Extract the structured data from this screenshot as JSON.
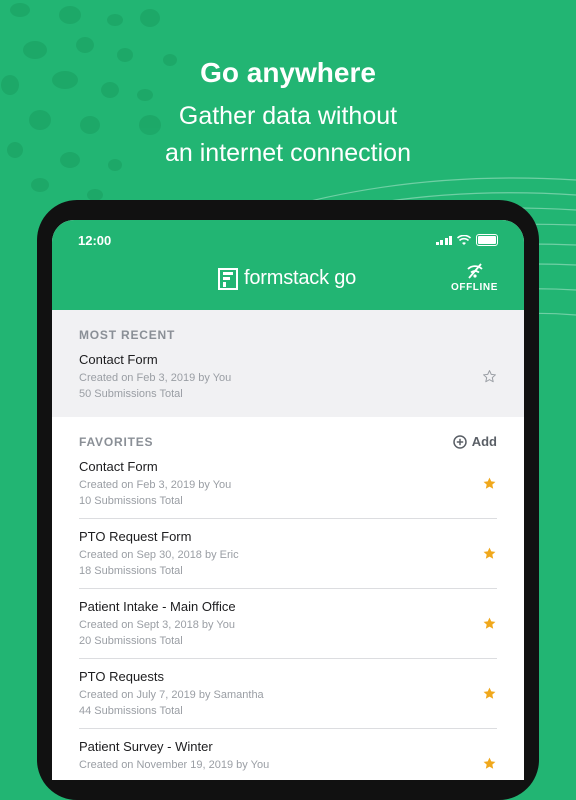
{
  "hero": {
    "title": "Go anywhere",
    "subtitle_line1": "Gather data without",
    "subtitle_line2": "an internet connection"
  },
  "status_bar": {
    "time": "12:00"
  },
  "app_header": {
    "logo_text": "formstack go",
    "offline_label": "OFFLINE"
  },
  "most_recent": {
    "heading": "MOST RECENT",
    "item": {
      "name": "Contact Form",
      "created": "Created on Feb 3, 2019 by You",
      "submissions": "50 Submissions Total",
      "starred": false
    }
  },
  "favorites": {
    "heading": "FAVORITES",
    "add_label": "Add",
    "items": [
      {
        "name": "Contact Form",
        "created": "Created on Feb 3, 2019 by You",
        "submissions": "10 Submissions Total",
        "starred": true
      },
      {
        "name": "PTO Request Form",
        "created": "Created on Sep 30, 2018 by Eric",
        "submissions": "18 Submissions Total",
        "starred": true
      },
      {
        "name": "Patient Intake - Main Office",
        "created": "Created on Sept 3, 2018 by You",
        "submissions": "20 Submissions Total",
        "starred": true
      },
      {
        "name": "PTO Requests",
        "created": "Created on July 7, 2019 by Samantha",
        "submissions": "44 Submissions Total",
        "starred": true
      },
      {
        "name": "Patient Survey - Winter",
        "created": "Created on November 19, 2019 by You",
        "submissions": "",
        "starred": true
      }
    ]
  },
  "colors": {
    "brand_green": "#22b573",
    "star_gold": "#f0a81c",
    "star_outline": "#9a9ea4"
  }
}
